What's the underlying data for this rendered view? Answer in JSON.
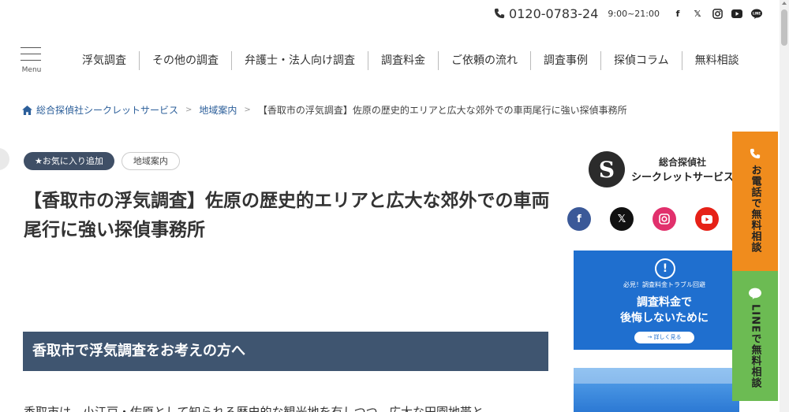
{
  "topbar": {
    "phone": "0120-0783-24",
    "hours": "9:00~21:00",
    "social_icons": [
      "facebook-icon",
      "x-icon",
      "instagram-icon",
      "youtube-icon",
      "line-icon"
    ]
  },
  "menu": {
    "label": "Menu"
  },
  "nav": {
    "items": [
      "浮気調査",
      "その他の調査",
      "弁護士・法人向け調査",
      "調査料金",
      "ご依頼の流れ",
      "調査事例",
      "探偵コラム",
      "無料相談"
    ]
  },
  "breadcrumb": {
    "home": "総合探偵社シークレットサービス",
    "category": "地域案内",
    "current": "【香取市の浮気調査】佐原の歴史的エリアと広大な郊外での車両尾行に強い探偵事務所"
  },
  "tags": {
    "favorite": "★お気に入り追加",
    "category": "地域案内"
  },
  "article": {
    "title": "【香取市の浮気調査】佐原の歴史的エリアと広大な郊外での車両尾行に強い探偵事務所",
    "section_heading": "香取市で浮気調査をお考えの方へ",
    "body_start": "香取市は、小江戸・佐原として知られる歴史的な観光地を有しつつ、広大な田園地帯と"
  },
  "sidebar": {
    "logo_line1": "総合探偵社",
    "logo_line2": "シークレットサービス",
    "banner1": {
      "small": "必見！調査料金トラブル回避",
      "big_line1": "調査料金で",
      "big_line2": "後悔しないために",
      "button": "→ 詳しく見る"
    }
  },
  "cta": {
    "call": "お電話で無料相談",
    "line": "LINEで無料相談"
  },
  "colors": {
    "accent_navy": "#3f5570",
    "link_blue": "#2c5f9a",
    "cta_orange": "#f08c1d",
    "cta_green": "#6cbb53",
    "banner_blue": "#1f6fcf"
  }
}
